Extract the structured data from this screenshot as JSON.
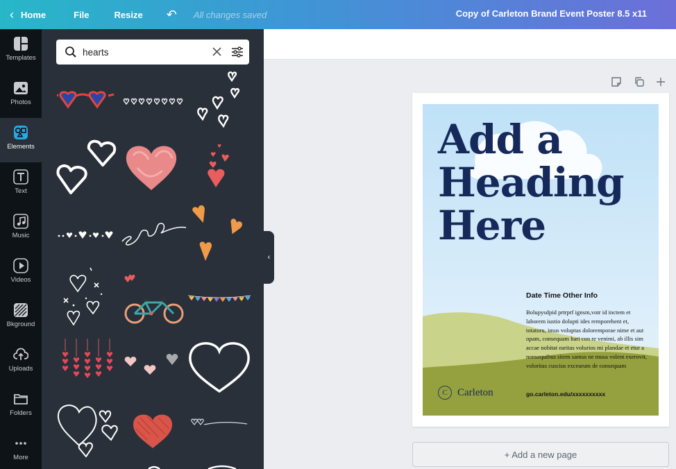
{
  "topbar": {
    "home_label": "Home",
    "file_label": "File",
    "resize_label": "Resize",
    "undo_icon": "undo-icon",
    "saved_status": "All changes saved",
    "document_title": "Copy of Carleton Brand Event Poster 8.5 x11"
  },
  "leftnav": {
    "items": [
      {
        "label": "Templates",
        "icon": "templates-icon"
      },
      {
        "label": "Photos",
        "icon": "photos-icon"
      },
      {
        "label": "Elements",
        "icon": "elements-icon"
      },
      {
        "label": "Text",
        "icon": "text-icon"
      },
      {
        "label": "Music",
        "icon": "music-icon"
      },
      {
        "label": "Videos",
        "icon": "videos-icon"
      },
      {
        "label": "Bkground",
        "icon": "background-icon"
      },
      {
        "label": "Uploads",
        "icon": "uploads-icon"
      },
      {
        "label": "Folders",
        "icon": "folders-icon"
      },
      {
        "label": "More",
        "icon": "more-icon"
      }
    ],
    "active": "Elements"
  },
  "panel": {
    "search": {
      "value": "hearts"
    },
    "results": [
      "heart-sunglasses",
      "row-of-small-hearts",
      "scattered-outline-hearts",
      "double-outline-hearts",
      "pink-painted-heart",
      "cluster-red-hearts",
      "dotted-heart-line",
      "heart-swirl-line",
      "orange-floating-hearts",
      "sparkle-outline-hearts",
      "tandem-bike-hearts",
      "colorful-heart-bunting",
      "hanging-heart-strings",
      "pink-grey-hearts",
      "big-outline-heart",
      "stacked-outline-hearts",
      "red-scribble-heart",
      "heart-line-divider"
    ]
  },
  "canvas": {
    "heading": [
      "Add a",
      "Heading",
      "Here"
    ],
    "info_title": "Date Time Other Info",
    "info_body": "Bolupysdpid prtrprf ignsm,votr id inctem et laborem iustio dolupti ides remporehent et, totatoru, imus voluptas doloremporae nime et aut opam, consequam hari con re venimi, ab illis sim accae nobitat earitas volurios mi plandae et etur a nonsequibus sitem samus ne musa volent exerovit, voloritas cuscius excearum de consequam",
    "brand_name": "Carleton",
    "brand_seal": "C",
    "url": "go.carleton.edu/xxxxxxxxxx",
    "colors": {
      "sky_top": "#bfe1f7",
      "sky_bottom": "#eaf4fb",
      "hill_light": "#c9d38a",
      "hill_dark": "#95a03e",
      "heading": "#15295a"
    }
  },
  "add_page_label": "+ Add a new page"
}
